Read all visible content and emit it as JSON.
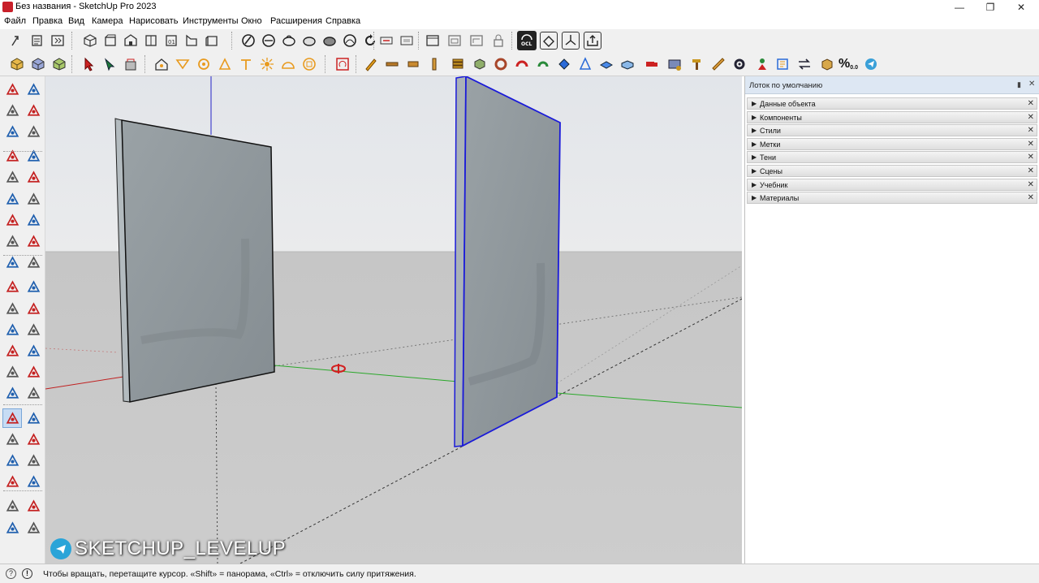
{
  "window": {
    "title": "Без названия - SketchUp Pro 2023",
    "min_glyph": "—",
    "max_glyph": "❐",
    "close_glyph": "✕"
  },
  "menu": [
    {
      "label": "Файл"
    },
    {
      "label": "Правка"
    },
    {
      "label": "Вид"
    },
    {
      "label": "Камера"
    },
    {
      "label": "Нарисовать"
    },
    {
      "label": "Инструменты"
    },
    {
      "label": "Окно"
    },
    {
      "label": "Расширения"
    },
    {
      "label": "Справка"
    }
  ],
  "toolbar_top": {
    "icons": [
      "new-file-icon",
      "open-file-icon",
      "save-icon",
      "warehouse-icon",
      "iso-view-icon",
      "top-view-icon",
      "front-view-icon",
      "right-view-icon",
      "back-view-icon",
      "left-view-icon",
      "xray-icon",
      "back-edges-icon",
      "wireframe-icon",
      "hidden-line-icon",
      "shaded-icon",
      "shaded-textures-icon",
      "monochrome-icon",
      "section-plane-icon",
      "section-cuts-icon",
      "section-fill-icon",
      "display-sections-icon",
      "scene-icon",
      "ocl-icon",
      "extension-box-icon",
      "axes-icon",
      "export-icon"
    ]
  },
  "toolbar_bottom": {
    "icons": [
      "solid-tools-icon",
      "outer-shell-icon",
      "intersect-icon",
      "select-icon",
      "paint-icon",
      "component-icon",
      "house-icon",
      "draw-tool-icon",
      "circle-tool-icon",
      "triangle-icon",
      "follow-icon",
      "sun-icon",
      "dome-icon",
      "box-icon",
      "warning-icon",
      "pencil-icon",
      "plank-icon",
      "beam-icon",
      "board-icon",
      "stack-icon",
      "cube-icon",
      "ring-icon",
      "chevron-icon",
      "plant-icon",
      "paint-bucket-icon",
      "drape-icon",
      "flatten-icon",
      "truck-icon",
      "hammer-icon",
      "ruler-icon",
      "gear-icon",
      "person-icon",
      "frame-icon",
      "swap-icon",
      "box-3d-icon",
      "percent-icon",
      "telegram-icon"
    ],
    "percent_label": "%",
    "percent_sub": "0.0"
  },
  "left_tools": [
    "select-arrow-icon",
    "lasso-icon",
    "paint-bucket-icon",
    "eraser-icon",
    "component-icon",
    "tag-eraser-icon",
    "pencil-line-icon",
    "freehand-icon",
    "rectangle-icon",
    "rotated-rectangle-icon",
    "circle-icon",
    "polygon-icon",
    "arc-icon",
    "two-point-arc-icon",
    "three-point-arc-icon",
    "pie-icon",
    "move-icon",
    "push-pull-icon",
    "rotate-icon",
    "follow-me-icon",
    "scale-icon",
    "offset-icon",
    "intersect-axes-icon",
    "tape-measure-icon",
    "dimension-icon",
    "protractor-icon",
    "text-icon",
    "text-3d-icon",
    "section-icon",
    "axes-text-icon",
    "orbit-icon",
    "pan-icon",
    "zoom-icon",
    "zoom-window-icon",
    "zoom-extents-icon",
    "previous-view-icon",
    "position-camera-icon",
    "walk-icon",
    "look-around-icon",
    "sandbox-icon",
    "layers-icon",
    "more-icon"
  ],
  "watermark": {
    "text": "SKETCHUP_LEVELUP"
  },
  "tray": {
    "title": "Лоток по умолчанию",
    "panels": [
      {
        "label": "Данные объекта"
      },
      {
        "label": "Компоненты"
      },
      {
        "label": "Стили"
      },
      {
        "label": "Метки"
      },
      {
        "label": "Тени"
      },
      {
        "label": "Сцены"
      },
      {
        "label": "Учебник"
      },
      {
        "label": "Материалы"
      }
    ]
  },
  "status": {
    "text": "Чтобы вращать, перетащите курсор. «Shift» = панорама, «Ctrl» = отключить силу притяжения."
  },
  "colors": {
    "sky": "#e6e8ec",
    "ground": "#c9c9c9",
    "panel_face": "#8f979c",
    "panel_edge": "#b9c1c5",
    "selection": "#1a1ad9",
    "axis_red": "#d21f1f",
    "axis_green": "#2aa82a",
    "axis_blue": "#2424c8"
  }
}
